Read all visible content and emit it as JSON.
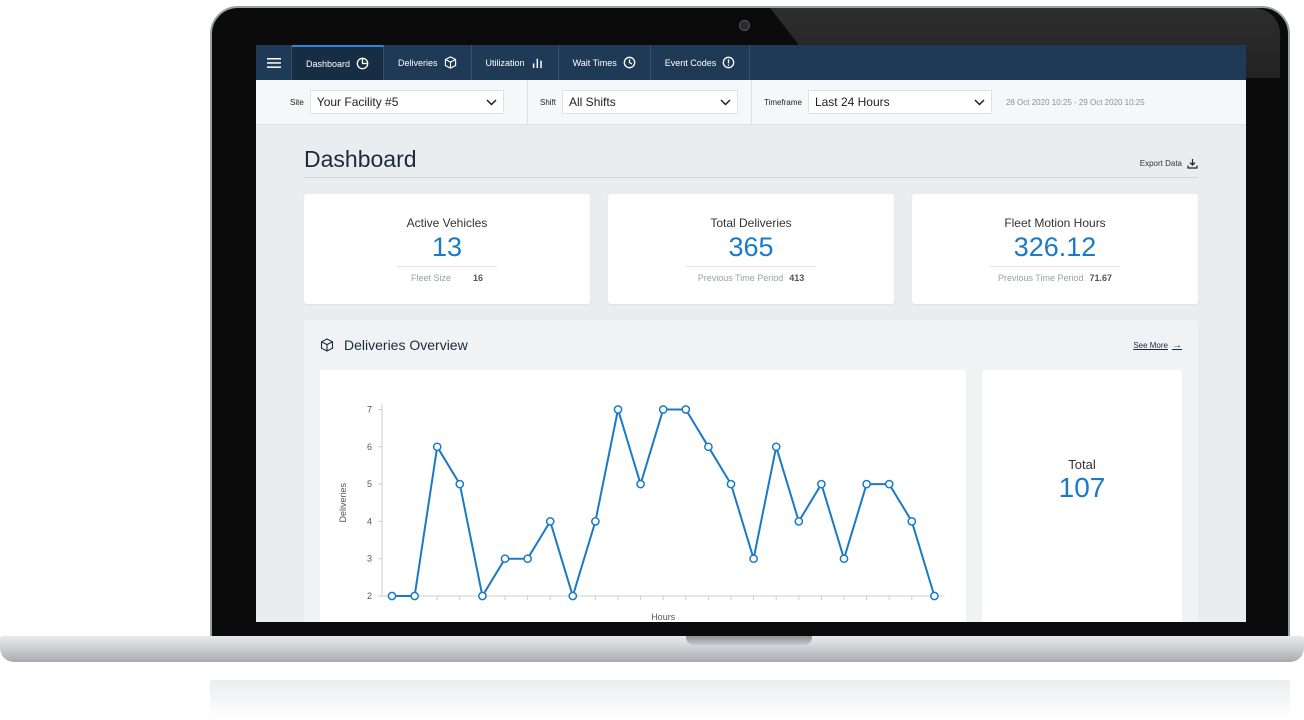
{
  "nav": {
    "tabs": [
      {
        "label": "Dashboard",
        "icon": "pie-clock-icon",
        "active": true
      },
      {
        "label": "Deliveries",
        "icon": "box-icon"
      },
      {
        "label": "Utilization",
        "icon": "bar-chart-icon"
      },
      {
        "label": "Wait Times",
        "icon": "clock-icon"
      },
      {
        "label": "Event Codes",
        "icon": "alert-circle-icon"
      }
    ]
  },
  "filters": {
    "site": {
      "label": "Site",
      "value": "Your Facility #5"
    },
    "shift": {
      "label": "Shift",
      "value": "All Shifts"
    },
    "timeframe": {
      "label": "Timeframe",
      "value": "Last 24 Hours"
    },
    "date_range": "28 Oct 2020 10:25 - 29 Oct 2020 10:25"
  },
  "page": {
    "title": "Dashboard",
    "export_label": "Export Data"
  },
  "cards": [
    {
      "label": "Active Vehicles",
      "value": "13",
      "sub_label": "Fleet Size",
      "sub_value": "16"
    },
    {
      "label": "Total Deliveries",
      "value": "365",
      "sub_label": "Previous Time Period",
      "sub_value": "413"
    },
    {
      "label": "Fleet Motion Hours",
      "value": "326.12",
      "sub_label": "Previous Time Period",
      "sub_value": "71.67"
    }
  ],
  "overview": {
    "title": "Deliveries Overview",
    "see_more": "See More",
    "total_label": "Total",
    "total_value": "107"
  },
  "colors": {
    "accent": "#1a7ac6",
    "nav_bg": "#1e3a56"
  },
  "chart_data": {
    "type": "line",
    "ylabel": "Deliveries",
    "xlabel": "Hours",
    "yticks": [
      2,
      3,
      4,
      5,
      6,
      7
    ],
    "values": [
      2,
      2,
      6,
      5,
      2,
      3,
      3,
      4,
      2,
      4,
      7,
      5,
      7,
      7,
      6,
      5,
      3,
      6,
      4,
      5,
      3,
      5,
      5,
      4,
      2
    ],
    "grid": false
  }
}
